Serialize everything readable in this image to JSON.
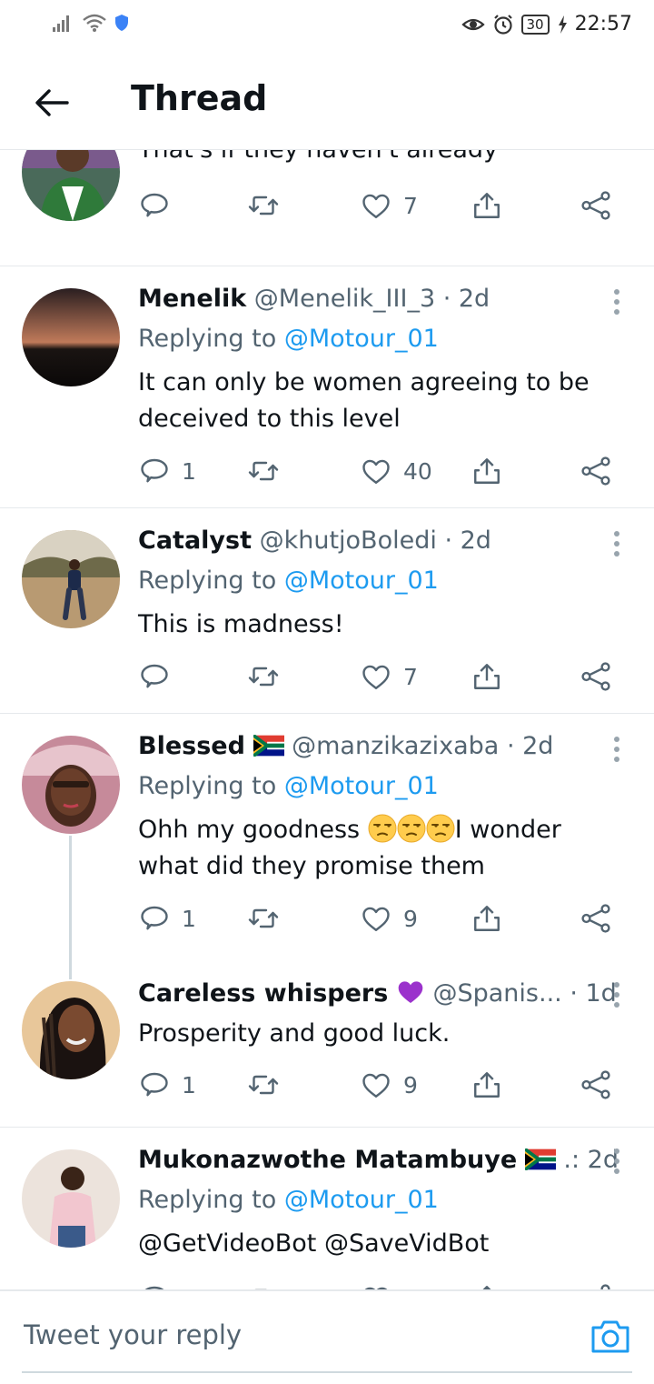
{
  "status_bar": {
    "battery": "30",
    "time": "22:57"
  },
  "header": {
    "title": "Thread"
  },
  "colors": {
    "accent": "#1d9bf0",
    "text": "#0f1419",
    "secondary": "#536471",
    "divider": "#e6e9ec"
  },
  "tweets": [
    {
      "text": "That's if they haven't already",
      "counts": {
        "reply": "",
        "retweet": "",
        "like": "7"
      }
    },
    {
      "name": "Menelik",
      "handle": "@Menelik_III_3",
      "time": "· 2d",
      "replying_prefix": "Replying to",
      "replying_to": "@Motour_01",
      "text": "It can only be women agreeing to be deceived to this level",
      "counts": {
        "reply": "1",
        "retweet": "",
        "like": "40"
      }
    },
    {
      "name": "Catalyst",
      "handle": "@khutjoBoledi",
      "time": "· 2d",
      "replying_prefix": "Replying to",
      "replying_to": "@Motour_01",
      "text": "This is madness!",
      "counts": {
        "reply": "",
        "retweet": "",
        "like": "7"
      }
    },
    {
      "name": "Blessed",
      "handle": "@manzikazixaba",
      "time": "· 2d",
      "replying_prefix": "Replying to",
      "replying_to": "@Motour_01",
      "text_a": "Ohh my goodness",
      "text_b": "I wonder what did they promise them",
      "counts": {
        "reply": "1",
        "retweet": "",
        "like": "9"
      }
    },
    {
      "name": "Careless whispers",
      "handle": "@Spanis...",
      "time": "· 1d",
      "text": "Prosperity and good luck.",
      "counts": {
        "reply": "1",
        "retweet": "",
        "like": "9"
      }
    },
    {
      "name": "Mukonazwothe Matambuye",
      "handle": ".:",
      "time": "2d",
      "replying_prefix": "Replying to",
      "replying_to": "@Motour_01",
      "mentions": "@GetVideoBot @SaveVidBot"
    }
  ],
  "compose": {
    "placeholder": "Tweet your reply"
  },
  "icons": [
    "signal-icon",
    "wifi-icon",
    "shield-icon",
    "eye-icon",
    "alarm-icon",
    "charging-icon",
    "back-arrow-icon",
    "reply-icon",
    "retweet-icon",
    "like-icon",
    "share-icon",
    "more-icon",
    "camera-icon",
    "purple-heart-emoji",
    "unamused-face-emoji",
    "south-africa-flag"
  ]
}
